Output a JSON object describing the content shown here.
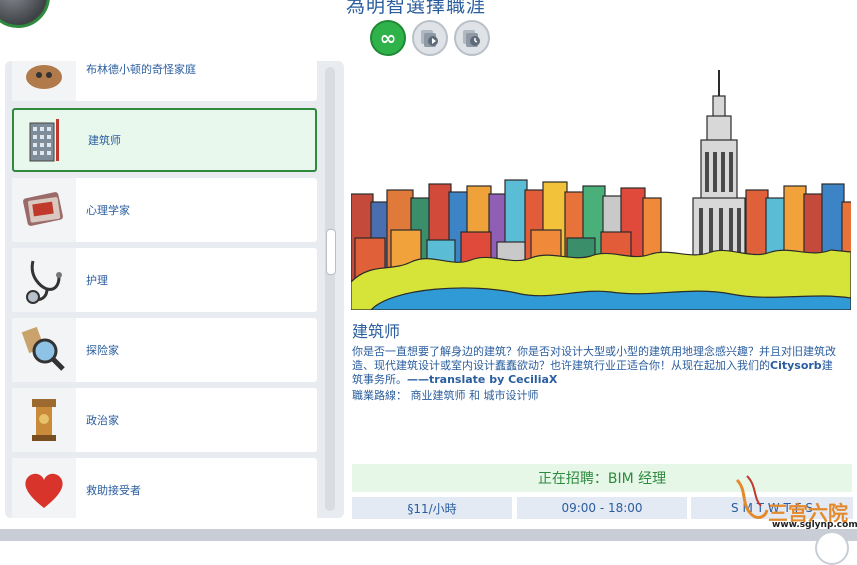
{
  "header": {
    "title": "為明智選擇職涯",
    "mode_buttons": [
      {
        "name": "infinite-icon",
        "symbol": "∞"
      },
      {
        "name": "play-icon"
      },
      {
        "name": "clock-icon"
      }
    ]
  },
  "career_list": [
    {
      "label": "布林德小顿的奇怪家庭",
      "icon": "dog-icon"
    },
    {
      "label": "建筑师",
      "icon": "building-icon",
      "selected": true
    },
    {
      "label": "心理学家",
      "icon": "books-icon"
    },
    {
      "label": "护理",
      "icon": "stethoscope-icon"
    },
    {
      "label": "探险家",
      "icon": "magnifier-icon"
    },
    {
      "label": "政治家",
      "icon": "podium-icon"
    },
    {
      "label": "救助接受者",
      "icon": "heart-icon"
    }
  ],
  "detail": {
    "title": "建筑师",
    "desc_part1": "你是否一直想要了解身边的建筑？你是否对设计大型或小型的建筑用地理念感兴趣？并且对旧建筑改造、现代建筑设计或室内设计蠢蠢欲动？也许建筑行业正适合你！从现在起加入我们的",
    "desc_bold1": "Citysorb",
    "desc_part2": "建筑事务所。",
    "desc_bold2": "——translate by CeciliaX",
    "path_label": "職業路線：",
    "path_value": "商业建筑师 和 城市设计师",
    "hiring": "正在招聘：BIM 经理",
    "pay": "§11/小時",
    "hours": "09:00 -   18:00",
    "days": "S M T W T F S"
  },
  "watermark": {
    "text": "三宫六院",
    "url": "www.sglynp.com"
  },
  "colors": {
    "accent_green": "#2f8a3e",
    "text_blue": "#2a5d9e",
    "hiring_bg": "#e6f7e8"
  }
}
